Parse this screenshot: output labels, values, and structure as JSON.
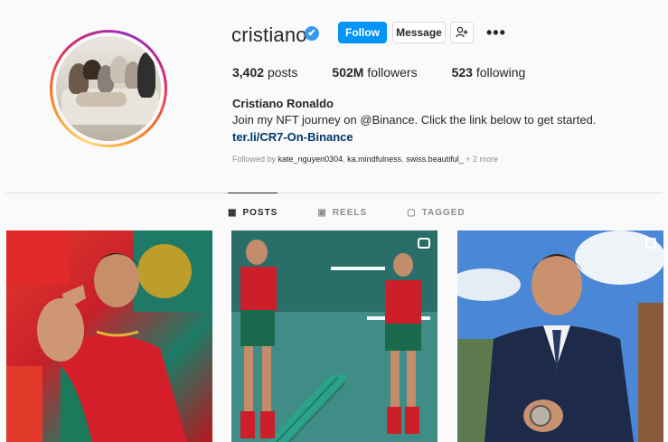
{
  "profile": {
    "username": "cristiano",
    "verified_badge": "✔",
    "full_name": "Cristiano Ronaldo",
    "bio": "Join my NFT journey on @Binance. Click the link below to get started.",
    "link": "ter.li/CR7-On-Binance"
  },
  "actions": {
    "follow_label": "Follow",
    "message_label": "Message",
    "suggest_icon": "add-user-icon",
    "more_icon": "more-dots-icon",
    "more_glyph": "•••"
  },
  "stats": {
    "posts_count": "3,402",
    "posts_label": "posts",
    "followers_count": "502M",
    "followers_label": "followers",
    "following_count": "523",
    "following_label": "following"
  },
  "followed_by": {
    "prefix": "Followed by",
    "user1": "kate_nguyen0304",
    "user2": "ka.mindfulness",
    "user3": "swiss.beautiful_",
    "more": "+ 2 more"
  },
  "tabs": [
    {
      "label": "POSTS",
      "icon": "grid-icon",
      "glyph": "▦"
    },
    {
      "label": "REELS",
      "icon": "reels-icon",
      "glyph": "▣"
    },
    {
      "label": "TAGGED",
      "icon": "tag-icon",
      "glyph": "▢"
    }
  ],
  "colors": {
    "primary_blue": "#0095f6",
    "verified_blue": "#3897f0",
    "link_blue": "#00376b"
  }
}
